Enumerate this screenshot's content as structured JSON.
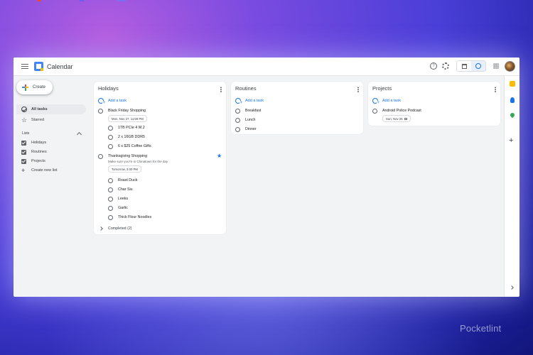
{
  "app": {
    "title": "Calendar"
  },
  "header": {
    "help_glyph": "?",
    "icons": [
      "help-icon",
      "gear-icon",
      "calendar-view-icon",
      "tasks-view-icon",
      "apps-grid-icon",
      "avatar"
    ]
  },
  "sidebar": {
    "create_label": "Create",
    "nav": [
      {
        "label": "All tasks",
        "icon": "check-circle-icon",
        "active": true
      },
      {
        "label": "Starred",
        "icon": "star-icon",
        "active": false
      }
    ],
    "lists_header": "Lists",
    "lists": [
      {
        "label": "Holidays",
        "checked": true
      },
      {
        "label": "Routines",
        "checked": true
      },
      {
        "label": "Projects",
        "checked": true
      }
    ],
    "create_list_label": "Create new list"
  },
  "boards": [
    {
      "title": "Holidays",
      "add_task": "Add a task",
      "tasks": [
        {
          "label": "Black Friday Shopping",
          "date": "Mon, Nov 27, 11:59 PM"
        },
        {
          "label": "1TB PCIe 4 M.2",
          "subtask": true
        },
        {
          "label": "2 x 16GB DDR5",
          "subtask": true
        },
        {
          "label": "6 x $25 Coffee Gifts",
          "subtask": true
        },
        {
          "label": "Thanksgiving Shopping",
          "note": "Make sure you're in Chinatown for the day",
          "date": "Tomorrow, 3:00 PM",
          "starred": true
        },
        {
          "label": "Roast Duck",
          "subtask": true
        },
        {
          "label": "Char Siu",
          "subtask": true
        },
        {
          "label": "Leeks",
          "subtask": true
        },
        {
          "label": "Garlic",
          "subtask": true
        },
        {
          "label": "Thick Flour Noodles",
          "subtask": true
        }
      ],
      "completed": "Completed (2)"
    },
    {
      "title": "Routines",
      "add_task": "Add a task",
      "tasks": [
        {
          "label": "Breakfast"
        },
        {
          "label": "Lunch"
        },
        {
          "label": "Dinner"
        }
      ]
    },
    {
      "title": "Projects",
      "add_task": "Add a task",
      "tasks": [
        {
          "label": "Android Police Podcast",
          "date": "Sun, Nov 26"
        }
      ]
    }
  ],
  "side_panel": {
    "icons": [
      "keep-icon",
      "contacts-icon",
      "maps-icon",
      "add-addon-icon",
      "expand-panel-icon"
    ]
  },
  "watermark": "Pocketlint",
  "colors": {
    "accent": "#1a73e8",
    "background_top": "#b45ee0",
    "background_bottom": "#12167a",
    "window": "#f1f3f4"
  }
}
